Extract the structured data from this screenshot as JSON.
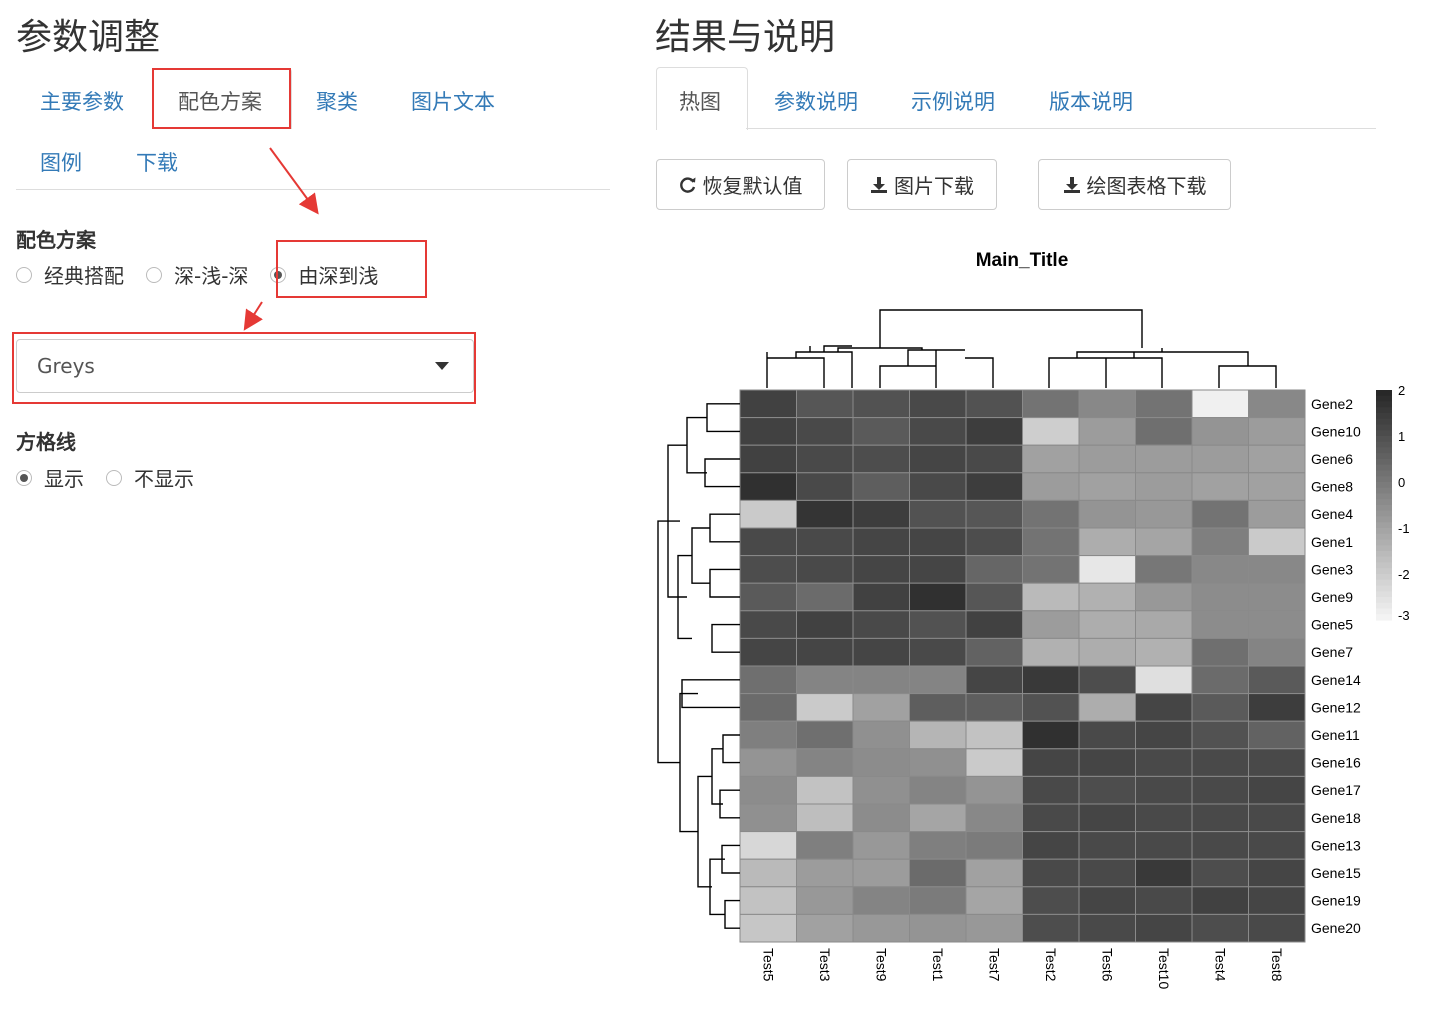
{
  "left": {
    "title": "参数调整",
    "tabs": [
      "主要参数",
      "配色方案",
      "聚类",
      "图片文本",
      "图例",
      "下载"
    ],
    "active_tab": "配色方案",
    "color_scheme": {
      "label": "配色方案",
      "options": [
        "经典搭配",
        "深-浅-深",
        "由深到浅"
      ],
      "selected": "由深到浅",
      "palette": "Greys"
    },
    "grid": {
      "label": "方格线",
      "options": [
        "显示",
        "不显示"
      ],
      "selected": "显示"
    }
  },
  "right": {
    "title": "结果与说明",
    "tabs": [
      "热图",
      "参数说明",
      "示例说明",
      "版本说明"
    ],
    "active_tab": "热图",
    "buttons": {
      "reset": "恢复默认值",
      "download_image": "图片下载",
      "download_table": "绘图表格下载"
    },
    "icons": {
      "reset": "refresh-icon",
      "download": "download-icon",
      "arrow": "red-arrow-annotation"
    },
    "accent_color": "#337ab7",
    "annotation_color": "#e53935"
  },
  "chart_data": {
    "type": "heatmap",
    "title": "Main_Title",
    "columns": [
      "Test5",
      "Test3",
      "Test9",
      "Test1",
      "Test7",
      "Test2",
      "Test6",
      "Test10",
      "Test4",
      "Test8"
    ],
    "rows": [
      "Gene2",
      "Gene10",
      "Gene6",
      "Gene8",
      "Gene4",
      "Gene1",
      "Gene3",
      "Gene9",
      "Gene5",
      "Gene7",
      "Gene14",
      "Gene12",
      "Gene11",
      "Gene16",
      "Gene17",
      "Gene18",
      "Gene13",
      "Gene15",
      "Gene19",
      "Gene20"
    ],
    "values": [
      [
        1.4,
        0.9,
        1.0,
        1.2,
        1.0,
        0.2,
        -0.3,
        0.2,
        -2.8,
        -0.3
      ],
      [
        1.4,
        1.2,
        0.8,
        1.2,
        1.5,
        -2.0,
        -0.8,
        0.3,
        -0.6,
        -0.8
      ],
      [
        1.4,
        1.2,
        1.1,
        1.3,
        1.2,
        -0.9,
        -0.8,
        -0.8,
        -0.8,
        -0.9
      ],
      [
        1.8,
        1.2,
        0.7,
        1.2,
        1.5,
        -0.8,
        -0.9,
        -0.8,
        -0.9,
        -0.9
      ],
      [
        -1.9,
        1.7,
        1.5,
        1.0,
        0.9,
        0.2,
        -0.6,
        -0.7,
        0.2,
        -0.8
      ],
      [
        1.2,
        1.2,
        1.3,
        1.3,
        1.1,
        0.2,
        -1.2,
        -1.0,
        -0.1,
        -1.9
      ],
      [
        1.1,
        1.2,
        1.3,
        1.3,
        0.5,
        0.2,
        -2.6,
        0.1,
        -0.3,
        -0.3
      ],
      [
        0.8,
        0.4,
        1.4,
        1.8,
        0.9,
        -1.5,
        -1.3,
        -0.7,
        -0.4,
        -0.4
      ],
      [
        1.2,
        1.4,
        1.2,
        1.0,
        1.4,
        -0.8,
        -1.2,
        -1.1,
        -0.4,
        -0.4
      ],
      [
        1.3,
        1.3,
        1.3,
        1.2,
        0.6,
        -1.3,
        -1.2,
        -1.3,
        0.3,
        -0.2
      ],
      [
        0.3,
        -0.2,
        -0.2,
        -0.2,
        1.3,
        1.6,
        1.1,
        -2.4,
        0.4,
        0.8
      ],
      [
        0.4,
        -1.9,
        -0.9,
        0.7,
        0.7,
        1.0,
        -1.2,
        1.3,
        0.8,
        1.5
      ],
      [
        -0.1,
        0.3,
        -0.5,
        -1.4,
        -1.7,
        1.8,
        1.2,
        1.3,
        1.0,
        0.6
      ],
      [
        -0.6,
        -0.2,
        -0.4,
        -0.5,
        -1.9,
        1.3,
        1.3,
        1.2,
        1.2,
        1.2
      ],
      [
        -0.4,
        -1.7,
        -0.5,
        -0.2,
        -0.6,
        1.2,
        1.1,
        1.2,
        1.2,
        1.3
      ],
      [
        -0.5,
        -1.6,
        -0.4,
        -1.0,
        -0.3,
        1.2,
        1.3,
        1.2,
        1.2,
        1.2
      ],
      [
        -2.2,
        -0.1,
        -0.7,
        -0.1,
        0.0,
        1.3,
        1.2,
        1.2,
        1.2,
        1.2
      ],
      [
        -1.5,
        -0.8,
        -0.8,
        0.4,
        -0.9,
        1.2,
        1.2,
        1.6,
        1.1,
        1.3
      ],
      [
        -1.7,
        -0.7,
        -0.2,
        0.0,
        -1.0,
        1.1,
        1.3,
        1.2,
        1.4,
        1.3
      ],
      [
        -1.8,
        -0.9,
        -0.7,
        -0.6,
        -0.7,
        1.1,
        1.2,
        1.3,
        1.1,
        1.2
      ]
    ],
    "color_scale": {
      "palette": "Greys",
      "ticks": [
        2,
        1,
        0,
        -1,
        -2,
        -3
      ],
      "range": [
        -3,
        2
      ]
    }
  }
}
